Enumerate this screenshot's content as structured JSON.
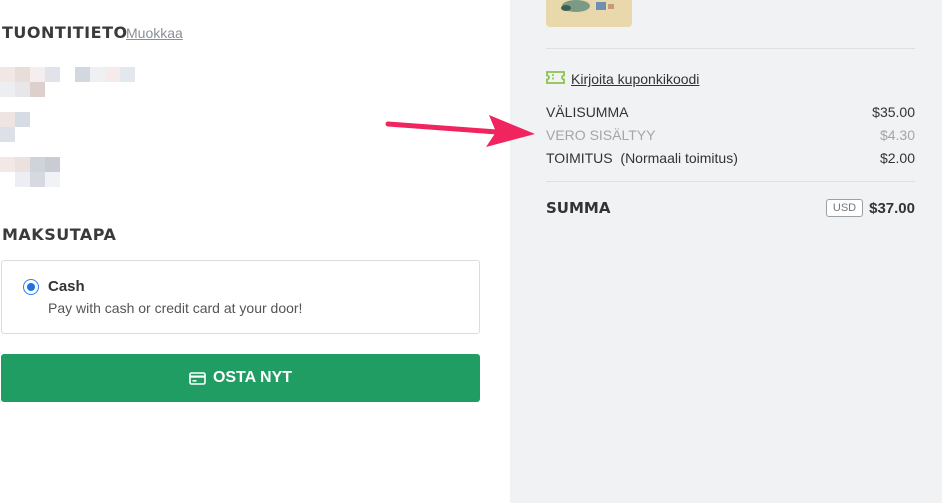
{
  "shipping": {
    "title": "TUONTITIETO",
    "edit_label": "Muokkaa"
  },
  "payment": {
    "title": "MAKSUTAPA",
    "method_name": "Cash",
    "method_desc": "Pay with cash or credit card at your door!"
  },
  "buy_button": {
    "label": "OSTA NYT",
    "icon": "credit-card-icon"
  },
  "summary": {
    "coupon_label": "Kirjoita kuponkikoodi",
    "rows": [
      {
        "label": "VÄLISUMMA",
        "value": "$35.00"
      },
      {
        "label": "VERO SISÄLTYY",
        "value": "$4.30"
      },
      {
        "label": "TOIMITUS  (Normaali toimitus)",
        "value": "$2.00"
      }
    ],
    "total_label": "SUMMA",
    "currency": "USD",
    "total_value": "$37.00"
  },
  "colors": {
    "accent_green": "#1f9d63",
    "arrow": "#f0245e",
    "sidebar_bg": "#f1f2f4",
    "coupon_icon": "#8bc34a"
  }
}
